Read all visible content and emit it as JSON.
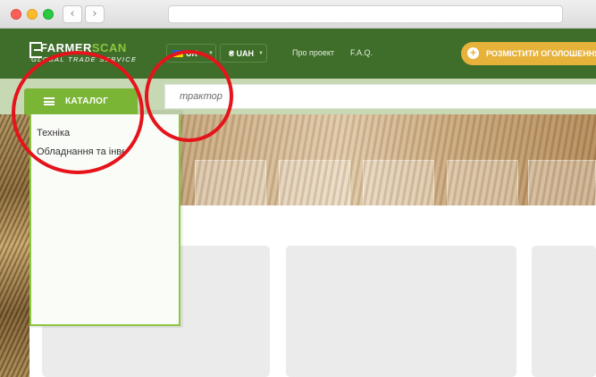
{
  "browser": {
    "back_glyph": "‹",
    "forward_glyph": "›"
  },
  "logo": {
    "part1": "FARMER",
    "part2": "SCAN",
    "tagline": "GLOBAL TRADE SERVICE"
  },
  "header": {
    "language": "UK",
    "currency": "₴ UAH",
    "caret_glyph": "▼",
    "nav": [
      {
        "label": "Про проект"
      },
      {
        "label": "F.A.Q."
      }
    ],
    "post_button": {
      "icon": "plus-icon",
      "plus_glyph": "+",
      "label": "РОЗМІСТИТИ ОГОЛОШЕННЯ"
    },
    "colors": {
      "header_bg": "#3f6e2b",
      "accent_green": "#8cc63f",
      "post_button": "#e7b23a"
    }
  },
  "search": {
    "placeholder": "трактор"
  },
  "catalog": {
    "button_label": "КАТАЛОГ",
    "items": [
      {
        "label": "Техніка"
      },
      {
        "label": "Обладнання та інвентар"
      }
    ]
  },
  "annotations": {
    "ring_color": "#e5141b"
  }
}
